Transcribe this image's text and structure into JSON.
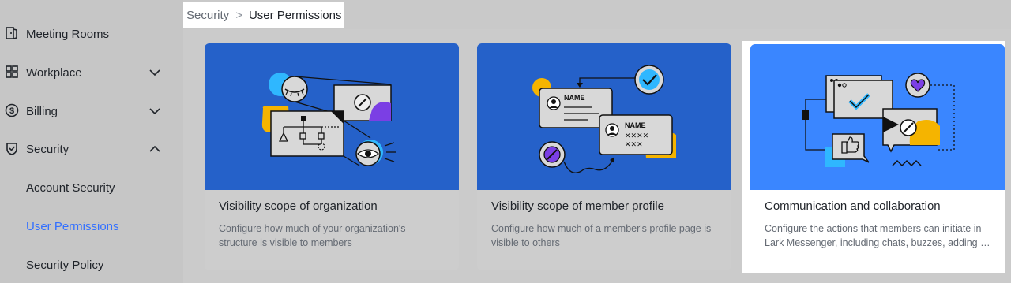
{
  "sidebar": {
    "items": [
      {
        "label": "Meeting Rooms",
        "icon": "door-icon",
        "expandable": false
      },
      {
        "label": "Workplace",
        "icon": "grid-icon",
        "expandable": true,
        "expanded": false
      },
      {
        "label": "Billing",
        "icon": "dollar-icon",
        "expandable": true,
        "expanded": false
      },
      {
        "label": "Security",
        "icon": "shield-icon",
        "expandable": true,
        "expanded": true
      },
      {
        "label": "Account Security"
      },
      {
        "label": "User Permissions",
        "active": true
      },
      {
        "label": "Security Policy"
      }
    ]
  },
  "breadcrumb": {
    "parent": "Security",
    "separator": ">",
    "current": "User Permissions"
  },
  "cards": [
    {
      "title": "Visibility scope of organization",
      "description": "Configure how much of your organization's structure is visible to members",
      "illustration": "org-structure-illustration"
    },
    {
      "title": "Visibility scope of member profile",
      "description": "Configure how much of a member's profile page is visible to others",
      "illustration": "profile-cards-illustration",
      "name_label_1": "NAME",
      "name_label_2": "NAME"
    },
    {
      "title": "Communication and collaboration",
      "description": "Configure the actions that members can initiate in Lark Messenger, including chats, buzzes, adding …",
      "illustration": "messaging-illustration",
      "highlighted": true
    }
  ],
  "colors": {
    "accent": "#3370ff",
    "banner_blue": "#2561c9",
    "banner_blue_highlight": "#3a86ff",
    "yellow": "#f5b400",
    "purple": "#7b3fe4",
    "cyan": "#2fb7ff"
  }
}
